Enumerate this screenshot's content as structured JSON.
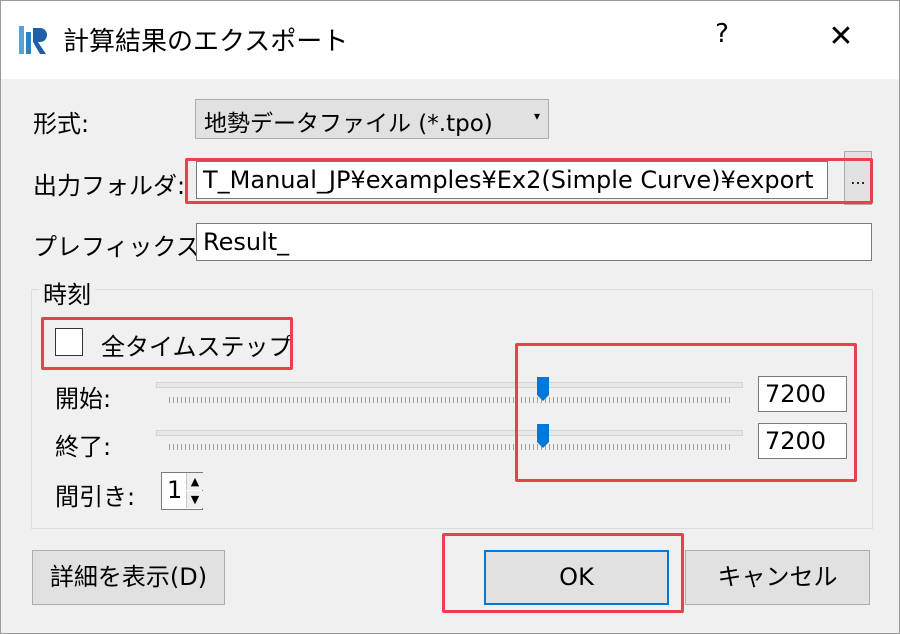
{
  "window": {
    "title": "計算結果のエクスポート",
    "help_label": "?",
    "close_label": "✕"
  },
  "format": {
    "label": "形式:",
    "selected": "地勢データファイル (*.tpo)"
  },
  "output_folder": {
    "label": "出力フォルダ:",
    "value": "T_Manual_JP¥examples¥Ex2(Simple Curve)¥export",
    "browse_label": "..."
  },
  "prefix": {
    "label": "プレフィックス:",
    "value": "Result_"
  },
  "time": {
    "group_label": "時刻",
    "all_steps_label": "全タイムステップ",
    "all_steps_checked": false,
    "start": {
      "label": "開始:",
      "value": "7200"
    },
    "end": {
      "label": "終了:",
      "value": "7200"
    },
    "skip": {
      "label": "間引き:",
      "value": "1"
    }
  },
  "buttons": {
    "details": "詳細を表示(D)",
    "ok": "OK",
    "cancel": "キャンセル"
  },
  "colors": {
    "accent": "#0078d7",
    "highlight": "#e8414a",
    "dialog_bg": "#f0f0f0"
  },
  "icons": {
    "app": "iric-logo-icon",
    "combo_arrow": "chevron-down-icon",
    "spin_up": "arrow-up-icon",
    "spin_down": "arrow-down-icon"
  }
}
